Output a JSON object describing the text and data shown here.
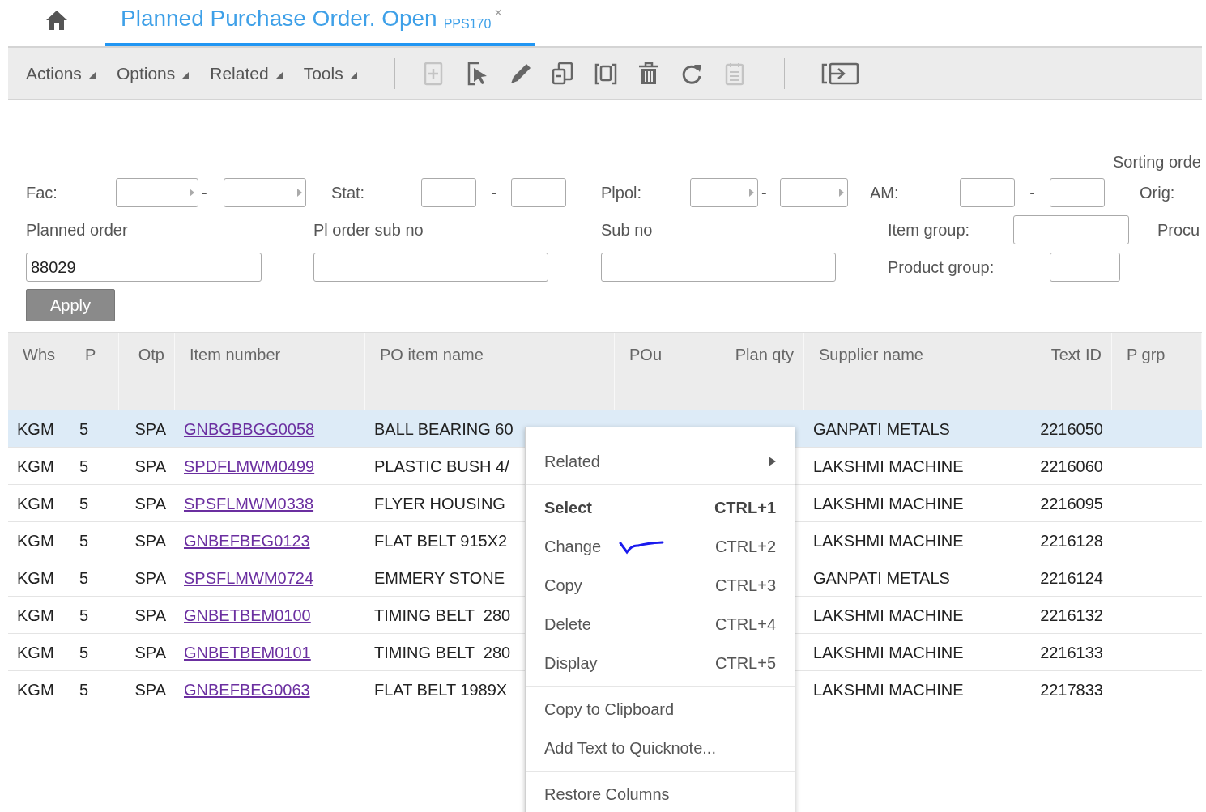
{
  "tab": {
    "title": "Planned Purchase Order. Open",
    "code": "PPS170",
    "close": "×",
    "selected": true
  },
  "menus": [
    "Actions",
    "Options",
    "Related",
    "Tools"
  ],
  "toolbar_icons": [
    {
      "kind": "new",
      "disabled": true
    },
    {
      "kind": "open",
      "disabled": false
    },
    {
      "kind": "edit",
      "disabled": false
    },
    {
      "kind": "copy",
      "disabled": false
    },
    {
      "kind": "duplicate",
      "disabled": false
    },
    {
      "kind": "delete",
      "disabled": false
    },
    {
      "kind": "refresh",
      "disabled": false
    },
    {
      "kind": "notes",
      "disabled": true
    },
    {
      "kind": "exit",
      "disabled": false
    }
  ],
  "sorting_label": "Sorting orde",
  "filters": {
    "range_row": [
      {
        "label": "Fac:",
        "arrows": true,
        "separator": "-"
      },
      {
        "label": "Stat:",
        "arrows": false,
        "separator": "-"
      },
      {
        "label": "Plpol:",
        "arrows": true,
        "separator": "-"
      },
      {
        "label": "AM:",
        "arrows": false,
        "separator": "-"
      },
      {
        "label": "Orig:"
      }
    ],
    "planned_order": {
      "label": "Planned order",
      "value": "88029"
    },
    "pl_order_sub_no": {
      "label": "Pl order sub no"
    },
    "sub_no": {
      "label": "Sub no"
    },
    "item_group": {
      "label": "Item group:"
    },
    "procu": {
      "label": "Procu"
    },
    "product_group": {
      "label": "Product group:"
    },
    "apply": "Apply"
  },
  "table": {
    "columns": [
      "Whs",
      "P",
      "Otp",
      "Item number",
      "PO item name",
      "POu",
      "Plan qty",
      "Supplier name",
      "Text ID",
      "P grp"
    ],
    "rows": [
      {
        "selected": true,
        "cells": [
          "KGM",
          "5",
          "SPA",
          "GNBGBBGG0058",
          "BALL BEARING 60",
          null,
          null,
          "GANPATI METALS",
          "2216050",
          null
        ]
      },
      {
        "selected": false,
        "cells": [
          "KGM",
          "5",
          "SPA",
          "SPDFLMWM0499",
          "PLASTIC BUSH 4/",
          null,
          null,
          "LAKSHMI MACHINE",
          "2216060",
          null
        ]
      },
      {
        "selected": false,
        "cells": [
          "KGM",
          "5",
          "SPA",
          "SPSFLMWM0338",
          "FLYER HOUSING",
          null,
          null,
          "LAKSHMI MACHINE",
          "2216095",
          null
        ]
      },
      {
        "selected": false,
        "cells": [
          "KGM",
          "5",
          "SPA",
          "GNBEFBEG0123",
          "FLAT BELT 915X2",
          null,
          null,
          "LAKSHMI MACHINE",
          "2216128",
          null
        ]
      },
      {
        "selected": false,
        "cells": [
          "KGM",
          "5",
          "SPA",
          "SPSFLMWM0724",
          "EMMERY STONE",
          null,
          null,
          "GANPATI METALS",
          "2216124",
          null
        ]
      },
      {
        "selected": false,
        "cells": [
          "KGM",
          "5",
          "SPA",
          "GNBETBEM0100",
          "TIMING BELT  280",
          null,
          null,
          "LAKSHMI MACHINE",
          "2216132",
          null
        ]
      },
      {
        "selected": false,
        "cells": [
          "KGM",
          "5",
          "SPA",
          "GNBETBEM0101",
          "TIMING BELT  280",
          null,
          null,
          "LAKSHMI MACHINE",
          "2216133",
          null
        ]
      },
      {
        "selected": false,
        "cells": [
          "KGM",
          "5",
          "SPA",
          "GNBEFBEG0063",
          "FLAT BELT 1989X",
          null,
          null,
          "LAKSHMI MACHINE",
          "2217833",
          null
        ]
      }
    ]
  },
  "context_menu": {
    "groups": [
      [
        {
          "kind": "submenu",
          "label": "Related"
        }
      ],
      [
        {
          "kind": "default",
          "label": "Select",
          "shortcut": "CTRL+1"
        },
        {
          "kind": "item",
          "label": "Change",
          "shortcut": "CTRL+2",
          "pen_mark": true
        },
        {
          "kind": "item",
          "label": "Copy",
          "shortcut": "CTRL+3"
        },
        {
          "kind": "item",
          "label": "Delete",
          "shortcut": "CTRL+4"
        },
        {
          "kind": "item",
          "label": "Display",
          "shortcut": "CTRL+5"
        }
      ],
      [
        {
          "kind": "item",
          "label": "Copy to Clipboard"
        },
        {
          "kind": "item",
          "label": "Add Text to Quicknote..."
        }
      ],
      [
        {
          "kind": "item",
          "label": "Restore Columns"
        }
      ]
    ]
  }
}
